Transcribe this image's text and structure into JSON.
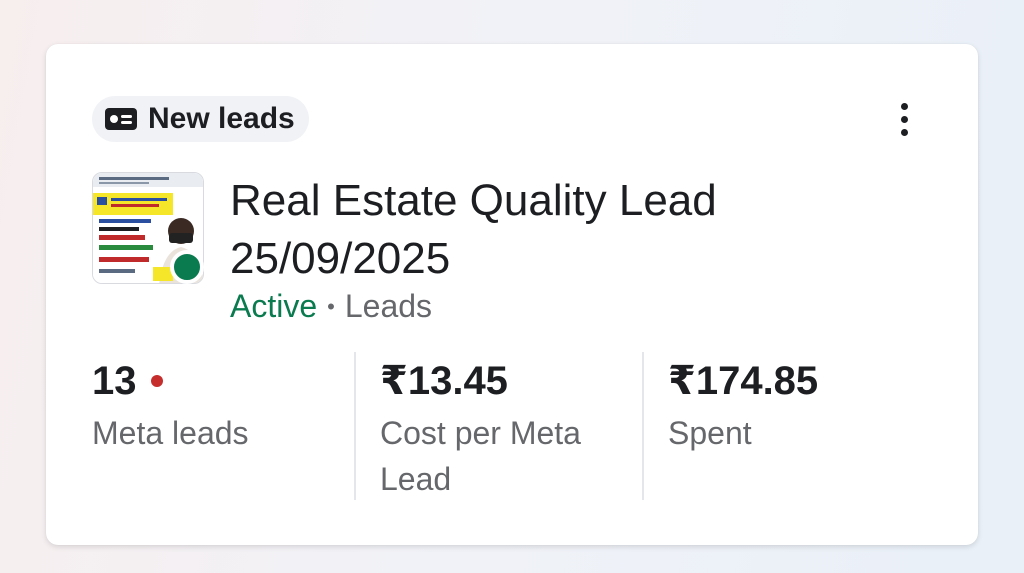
{
  "badge": {
    "icon": "lead-card-icon",
    "label": "New leads"
  },
  "menu": {
    "icon": "more-vertical-icon"
  },
  "campaign": {
    "thumbnail": "ad-creative-thumbnail",
    "title": "Real Estate Quality Lead 25/09/2025",
    "status": "Active",
    "separator": "•",
    "objective": "Leads",
    "status_color": "#0a7a4f"
  },
  "metrics": [
    {
      "value": "13",
      "label": "Meta leads",
      "alert": true
    },
    {
      "value": "₹13.45",
      "label": "Cost per Meta Lead"
    },
    {
      "value": "₹174.85",
      "label": "Spent"
    }
  ],
  "colors": {
    "alert_dot": "#c62e2e",
    "text_primary": "#1c1e21",
    "text_secondary": "#65676b"
  }
}
